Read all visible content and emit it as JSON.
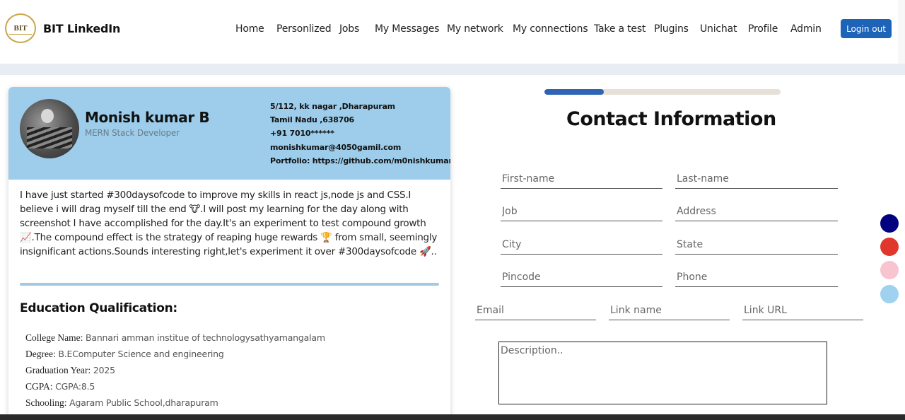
{
  "brand": {
    "logo_text": "BIT",
    "name": "BIT LinkedIn"
  },
  "nav": {
    "items": [
      "Home",
      "Personlized",
      "Jobs",
      "My Messages",
      "My network",
      "My connections",
      "Take a test",
      "Plugins",
      "Unichat",
      "Profile",
      "Admin"
    ],
    "logout_label": "Login out"
  },
  "profile": {
    "name": "Monish kumar B",
    "role": "MERN Stack Developer",
    "contact": [
      "5/112, kk nagar ,Dharapuram",
      "Tamil Nadu ,638706",
      "+91 7010******",
      "monishkumar@4050gamil.com",
      "Portfolio: https://github.com/m0nishkumar"
    ],
    "bio": "I have just started #300daysofcode to improve my skills in react js,node js and CSS.I believe i will drag myself till the end 🐮.I will post my learning for the day along with screenshot I have accomplished for the day.It's an experiment to test compound growth 📈.The compound effect is the strategy of reaping huge rewards 🏆 from small, seemingly insignificant actions.Sounds interesting right,let's experiment it over #300daysofcode 🚀.."
  },
  "education": {
    "title": "Education Qualification:",
    "rows": [
      {
        "label": "College Name:",
        "value": "Bannari amman institue of technologysathyamangalam"
      },
      {
        "label": "Degree:",
        "value": "B.EComputer Science and engineering"
      },
      {
        "label": "Graduation Year:",
        "value": "2025"
      },
      {
        "label": "CGPA:",
        "value": "CGPA:8.5"
      },
      {
        "label": "Schooling:",
        "value": "Agaram Public School,dharapuram"
      }
    ]
  },
  "form": {
    "step_progress": 0.25,
    "title": "Contact Information",
    "placeholders": {
      "first_name": "First-name",
      "last_name": "Last-name",
      "job": "Job",
      "address": "Address",
      "city": "City",
      "state": "State",
      "pincode": "Pincode",
      "phone": "Phone",
      "email": "Email",
      "link_name": "Link name",
      "link_url": "Link URL",
      "description": "Description.."
    }
  },
  "theme_colors": [
    "#000080",
    "#e0362c",
    "#f7c4cf",
    "#9fd2ee"
  ],
  "accent_colors": {
    "header_card": "#9dcdeb",
    "button": "#1d63b8",
    "progress": "#2f63b3"
  }
}
